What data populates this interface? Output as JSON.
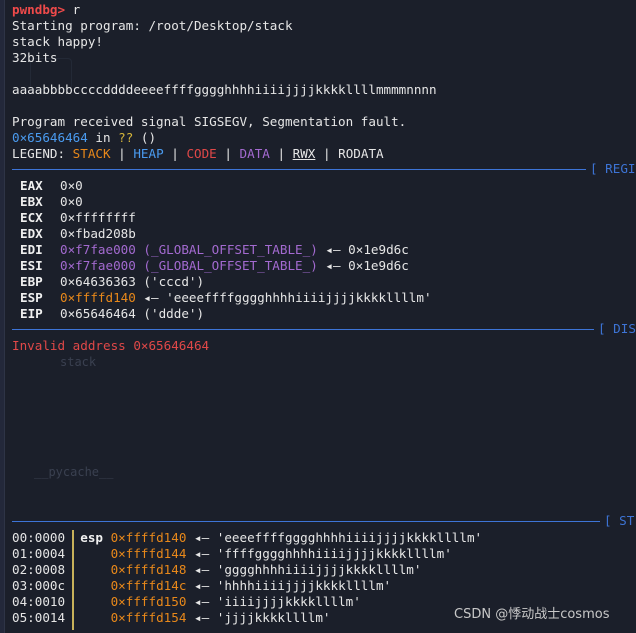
{
  "prompt": "pwndbg>",
  "command": "r",
  "output": {
    "starting": "Starting program: /root/Desktop/stack",
    "happy": "stack happy!",
    "bits": "32bits",
    "input": "aaaabbbbccccddddeeeeffffgggghhhhiiiijjjjkkkkllllmmmmnnnn",
    "signal": "Program received signal SIGSEGV, Segmentation fault.",
    "pc_addr": "0×65646464",
    "pc_in": " in ",
    "pc_q": "??",
    "pc_paren": " ()"
  },
  "legend": {
    "label": "LEGEND: ",
    "stack": "STACK",
    "heap": "HEAP",
    "code": "CODE",
    "data": "DATA",
    "rwx": "RWX",
    "rodata": "RODATA",
    "sep": " | "
  },
  "sections": {
    "regs": "[ REGI",
    "disasm": "[ DIS",
    "stack": "[ ST"
  },
  "registers": [
    {
      "name": "EAX",
      "value": "0×0",
      "kind": "plain"
    },
    {
      "name": "EBX",
      "value": "0×0",
      "kind": "plain"
    },
    {
      "name": "ECX",
      "value": "0×ffffffff",
      "kind": "plain"
    },
    {
      "name": "EDX",
      "value": "0×fbad208b",
      "kind": "plain"
    },
    {
      "name": "EDI",
      "value": "0×f7fae000",
      "extra": " (_GLOBAL_OFFSET_TABLE_)",
      "arrow": " ◂— ",
      "deref": "0×1e9d6c",
      "kind": "data"
    },
    {
      "name": "ESI",
      "value": "0×f7fae000",
      "extra": " (_GLOBAL_OFFSET_TABLE_)",
      "arrow": " ◂— ",
      "deref": "0×1e9d6c",
      "kind": "data"
    },
    {
      "name": "EBP",
      "value": "0×64636363",
      "extra": " ('cccd')",
      "kind": "plain"
    },
    {
      "name": "ESP",
      "value": "0×ffffd140",
      "arrow": " ◂— ",
      "deref": "'eeeeffffgggghhhhiiiijjjjkkkkllllm'",
      "kind": "stack"
    },
    {
      "name": "EIP",
      "value": "0×65646464",
      "extra": " ('ddde')",
      "kind": "plain"
    }
  ],
  "disasm": {
    "error": "Invalid address 0×65646464"
  },
  "stack": [
    {
      "idx": "00:0000",
      "reg": "esp",
      "addr": "0×ffffd140",
      "arrow": " ◂— ",
      "val": "'eeeeffffgggghhhhiiiijjjjkkkkllllm'"
    },
    {
      "idx": "01:0004",
      "reg": "",
      "addr": "0×ffffd144",
      "arrow": " ◂— ",
      "val": "'ffffgggghhhhiiiijjjjkkkkllllm'"
    },
    {
      "idx": "02:0008",
      "reg": "",
      "addr": "0×ffffd148",
      "arrow": " ◂— ",
      "val": "'gggghhhhiiiijjjjkkkkllllm'"
    },
    {
      "idx": "03:000c",
      "reg": "",
      "addr": "0×ffffd14c",
      "arrow": " ◂— ",
      "val": "'hhhhiiiijjjjkkkkllllm'"
    },
    {
      "idx": "04:0010",
      "reg": "",
      "addr": "0×ffffd150",
      "arrow": " ◂— ",
      "val": "'iiiijjjjkkkkllllm'"
    },
    {
      "idx": "05:0014",
      "reg": "",
      "addr": "0×ffffd154",
      "arrow": " ◂— ",
      "val": "'jjjjkkkkllllm'"
    }
  ],
  "background": {
    "file1": "stack",
    "file2": "__pycache__"
  },
  "watermark": "CSDN @悸动战士cosmos",
  "colors": {
    "bg": "#1b1f2a",
    "stack": "#e8881a",
    "heap": "#4a9bf0",
    "code": "#e04848",
    "data": "#a36ad0",
    "separator": "#3d74d6"
  }
}
